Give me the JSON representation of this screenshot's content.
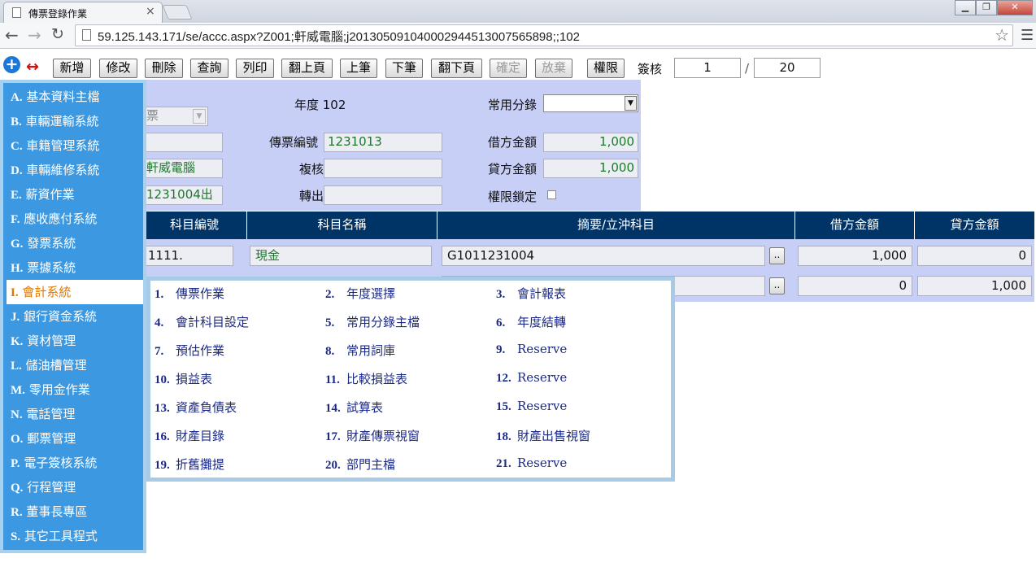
{
  "browser": {
    "tab_title": "傳票登錄作業",
    "tab_close": "×",
    "url": "59.125.143.171/se/accc.aspx?Z001;軒威電腦;j20130509104000294451300​7565898;;102"
  },
  "toolbar": {
    "buttons": [
      {
        "label": "新增",
        "enabled": true
      },
      {
        "label": "修改",
        "enabled": true
      },
      {
        "label": "刪除",
        "enabled": true
      },
      {
        "label": "查詢",
        "enabled": true
      },
      {
        "label": "列印",
        "enabled": true
      },
      {
        "label": "翻上頁",
        "enabled": true
      },
      {
        "label": "上筆",
        "enabled": true
      },
      {
        "label": "下筆",
        "enabled": true
      },
      {
        "label": "翻下頁",
        "enabled": true
      },
      {
        "label": "確定",
        "enabled": false
      },
      {
        "label": "放棄",
        "enabled": false
      },
      {
        "label": "權限",
        "enabled": true
      }
    ],
    "sign_label": "簽核",
    "page_current": "1",
    "page_separator": "/",
    "page_total": "20"
  },
  "form": {
    "type_value": "票",
    "year_label": "年度 102",
    "common_entry_label": "常用分錄",
    "common_entry_value": "",
    "voucher_no_label": "傳票編號",
    "voucher_no_value": "1231013",
    "debit_label": "借方金額",
    "debit_value": "1,000",
    "review_label": "複核",
    "review_value": "",
    "credit_label": "貸方金額",
    "credit_value": "1,000",
    "company_value": "軒威電腦",
    "transfer_label": "轉出",
    "transfer_value": "",
    "ref_value": "1231004出",
    "lock_label": "權限鎖定"
  },
  "grid": {
    "headers": [
      "科目編號",
      "科目名稱",
      "摘要/立沖科目",
      "借方金額",
      "貸方金額"
    ],
    "rows": [
      {
        "code": "1111.",
        "name": "現金",
        "memo": "G1011231004",
        "debit": "1,000",
        "credit": "0"
      },
      {
        "code": "",
        "name": "",
        "memo": "",
        "debit": "0",
        "credit": "1,000"
      }
    ],
    "picker_label": ".."
  },
  "sidebar": {
    "items": [
      {
        "key": "A.",
        "label": "基本資料主檔"
      },
      {
        "key": "B.",
        "label": "車輛運輸系統"
      },
      {
        "key": "C.",
        "label": "車籍管理系統"
      },
      {
        "key": "D.",
        "label": "車輛維修系統"
      },
      {
        "key": "E.",
        "label": "薪資作業"
      },
      {
        "key": "F.",
        "label": "應收應付系統"
      },
      {
        "key": "G.",
        "label": "發票系統"
      },
      {
        "key": "H.",
        "label": "票據系統"
      },
      {
        "key": "I.",
        "label": "會計系統"
      },
      {
        "key": "J.",
        "label": "銀行資金系統"
      },
      {
        "key": "K.",
        "label": "資材管理"
      },
      {
        "key": "L.",
        "label": "儲油槽管理"
      },
      {
        "key": "M.",
        "label": "零用金作業"
      },
      {
        "key": "N.",
        "label": "電話管理"
      },
      {
        "key": "O.",
        "label": "郵票管理"
      },
      {
        "key": "P.",
        "label": "電子簽核系統"
      },
      {
        "key": "Q.",
        "label": "行程管理"
      },
      {
        "key": "R.",
        "label": "董事長專區"
      },
      {
        "key": "S.",
        "label": "其它工具程式"
      }
    ],
    "active_index": 8
  },
  "submenu": {
    "items": [
      {
        "num": "1.",
        "label": "傳票作業"
      },
      {
        "num": "2.",
        "label": "年度選擇"
      },
      {
        "num": "3.",
        "label": "會計報表"
      },
      {
        "num": "4.",
        "label": "會計科目設定"
      },
      {
        "num": "5.",
        "label": "常用分錄主檔"
      },
      {
        "num": "6.",
        "label": "年度結轉"
      },
      {
        "num": "7.",
        "label": "預估作業"
      },
      {
        "num": "8.",
        "label": "常用詞庫"
      },
      {
        "num": "9.",
        "label": "Reserve"
      },
      {
        "num": "10.",
        "label": "損益表"
      },
      {
        "num": "11.",
        "label": "比較損益表"
      },
      {
        "num": "12.",
        "label": "Reserve"
      },
      {
        "num": "13.",
        "label": "資產負債表"
      },
      {
        "num": "14.",
        "label": "試算表"
      },
      {
        "num": "15.",
        "label": "Reserve"
      },
      {
        "num": "16.",
        "label": "財產目錄"
      },
      {
        "num": "17.",
        "label": "財產傳票視窗"
      },
      {
        "num": "18.",
        "label": "財產出售視窗"
      },
      {
        "num": "19.",
        "label": "折舊攤提"
      },
      {
        "num": "20.",
        "label": "部門主檔"
      },
      {
        "num": "21.",
        "label": "Reserve"
      }
    ]
  },
  "icons": {
    "add": "plus-circle-icon",
    "swap": "double-arrow-icon"
  }
}
